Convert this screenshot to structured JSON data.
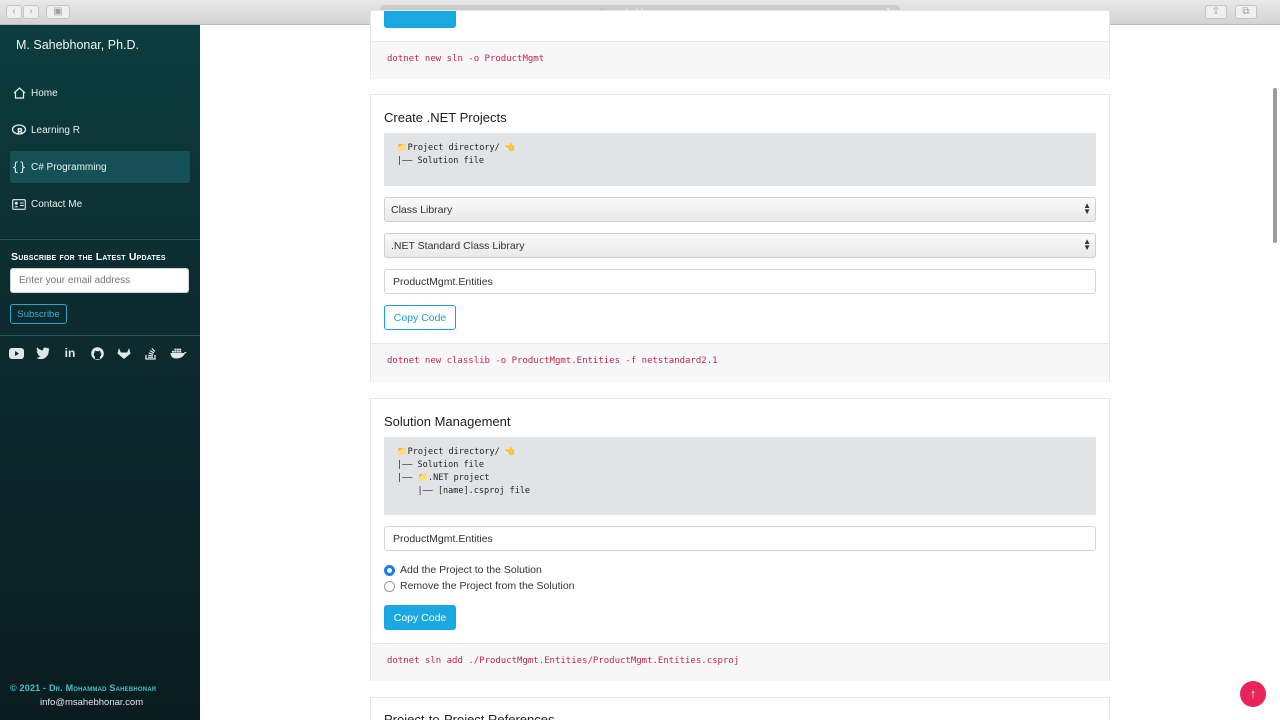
{
  "browser": {
    "url": "msahebhonar.com"
  },
  "sidebar": {
    "brand": "M. Sahebhonar, Ph.D.",
    "menu": [
      {
        "label": "Home",
        "icon": "home-icon"
      },
      {
        "label": "Learning R",
        "icon": "r-logo-icon"
      },
      {
        "label": "C# Programming",
        "icon": "braces-icon",
        "active": true
      },
      {
        "label": "Contact Me",
        "icon": "contact-card-icon"
      }
    ],
    "subscribe": {
      "title": "Subscribe for the Latest Updates",
      "placeholder": "Enter your email address",
      "button": "Subscribe"
    },
    "social": [
      "youtube-icon",
      "twitter-icon",
      "linkedin-icon",
      "github-icon",
      "gitlab-icon",
      "stackoverflow-icon",
      "docker-icon"
    ],
    "footer": {
      "copyright": "© 2021 - Dr. Mohammad Sahebhonar",
      "email": "info@msahebhonar.com"
    }
  },
  "cards": {
    "solution": {
      "code": "dotnet new sln -o ProductMgmt"
    },
    "create": {
      "title": "Create .NET Projects",
      "tree": [
        "📁Project directory/ 👈",
        "|—— Solution file"
      ],
      "select1": "Class Library",
      "select2": ".NET Standard Class Library",
      "name_value": "ProductMgmt.Entities",
      "button": "Copy Code",
      "code": "dotnet new classlib -o ProductMgmt.Entities -f netstandard2.1"
    },
    "manage": {
      "title": "Solution Management",
      "tree": [
        "📁Project directory/ 👈",
        "|—— Solution file",
        "|—— 📁.NET project",
        "    |—— [name].csproj file"
      ],
      "name_value": "ProductMgmt.Entities",
      "radio_add": "Add the Project to the Solution",
      "radio_remove": "Remove the Project from the Solution",
      "button": "Copy Code",
      "code": "dotnet sln add ./ProductMgmt.Entities/ProductMgmt.Entities.csproj"
    },
    "references": {
      "title": "Project-to-Project References"
    }
  },
  "colors": {
    "accent": "#19a9e0",
    "code": "#c7254e",
    "sidebar": "#0d2a2d",
    "top_button": "#e8245a"
  }
}
